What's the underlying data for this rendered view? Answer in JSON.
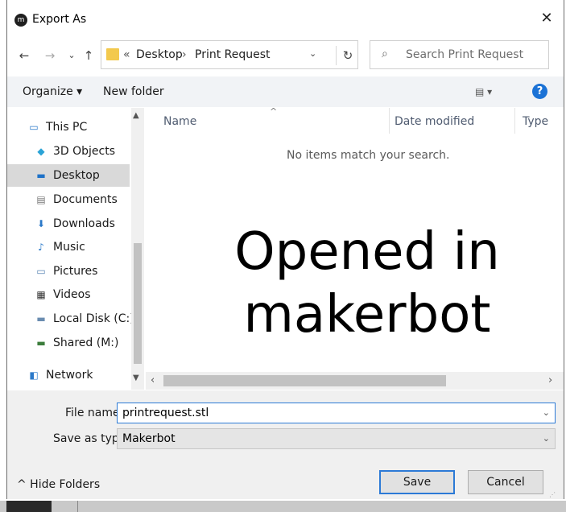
{
  "window": {
    "title": "Export As",
    "app_icon": "makerbot-app-icon",
    "close_glyph": "✕"
  },
  "nav_buttons": {
    "back": "←",
    "forward": "→",
    "recent": "⌄",
    "up": "↑"
  },
  "address": {
    "prefix": "«",
    "breadcrumbs": [
      "Desktop",
      "Print Request"
    ],
    "separator": "›",
    "dropdown": "⌄",
    "refresh": "↻"
  },
  "search": {
    "icon": "⌕",
    "placeholder": "Search Print Request"
  },
  "toolbar": {
    "organize": "Organize ▾",
    "new_folder": "New folder",
    "view": "▤ ▾",
    "help": "?"
  },
  "sidebar": {
    "items": [
      {
        "label": "This PC",
        "icon": "computer-icon",
        "glyph": "▭",
        "color": "#2b79c9"
      },
      {
        "label": "3D Objects",
        "icon": "3d-objects-icon",
        "glyph": "◆",
        "color": "#2aa3d6"
      },
      {
        "label": "Desktop",
        "icon": "desktop-icon",
        "glyph": "▬",
        "color": "#1e72c8",
        "selected": true
      },
      {
        "label": "Documents",
        "icon": "documents-icon",
        "glyph": "▤",
        "color": "#777777"
      },
      {
        "label": "Downloads",
        "icon": "downloads-icon",
        "glyph": "⬇",
        "color": "#2b79c9"
      },
      {
        "label": "Music",
        "icon": "music-icon",
        "glyph": "♪",
        "color": "#2b79c9"
      },
      {
        "label": "Pictures",
        "icon": "pictures-icon",
        "glyph": "▭",
        "color": "#5a86b4"
      },
      {
        "label": "Videos",
        "icon": "videos-icon",
        "glyph": "▦",
        "color": "#333333"
      },
      {
        "label": "Local Disk (C:)",
        "icon": "local-disk-icon",
        "glyph": "▬",
        "color": "#6a8cb0"
      },
      {
        "label": "Shared (M:)",
        "icon": "network-drive-icon",
        "glyph": "▬",
        "color": "#3c7d3c"
      },
      {
        "label": "Network",
        "icon": "network-icon",
        "glyph": "◧",
        "color": "#2b79c9"
      }
    ],
    "scroll_up": "▲",
    "scroll_down": "▼"
  },
  "columns": {
    "name": "Name",
    "date_modified": "Date modified",
    "type": "Type",
    "sort": "^"
  },
  "content": {
    "empty_message": "No items match your search.",
    "overlay_line1": "Opened in",
    "overlay_line2": "makerbot"
  },
  "hscroll": {
    "left": "‹",
    "right": "›"
  },
  "form": {
    "file_name_label": "File name:",
    "file_name_value": "printrequest.stl",
    "save_type_label": "Save as type:",
    "save_type_value": "Makerbot",
    "dropdown": "⌄"
  },
  "footer": {
    "hide_folders": "^  Hide Folders",
    "save": "Save",
    "cancel": "Cancel",
    "grip": "⋰"
  }
}
